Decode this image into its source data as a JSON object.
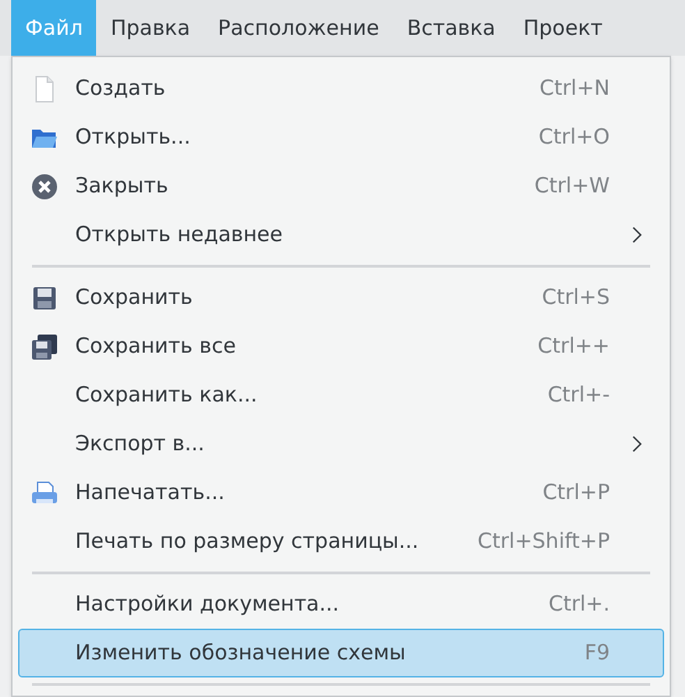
{
  "menubar": [
    {
      "label": "Файл",
      "selected": true
    },
    {
      "label": "Правка",
      "selected": false
    },
    {
      "label": "Расположение",
      "selected": false
    },
    {
      "label": "Вставка",
      "selected": false
    },
    {
      "label": "Проект",
      "selected": false
    }
  ],
  "menu": [
    {
      "kind": "item",
      "label": "Создать",
      "shortcut": "Ctrl+N",
      "selected": false
    },
    {
      "kind": "item",
      "label": "Открыть...",
      "shortcut": "Ctrl+O",
      "selected": false
    },
    {
      "kind": "item",
      "label": "Закрыть",
      "shortcut": "Ctrl+W",
      "selected": false
    },
    {
      "kind": "submenu",
      "label": "Открыть недавнее",
      "selected": false
    },
    {
      "kind": "separator"
    },
    {
      "kind": "item",
      "label": "Сохранить",
      "shortcut": "Ctrl+S",
      "selected": false
    },
    {
      "kind": "item",
      "label": "Сохранить все",
      "shortcut": "Ctrl++",
      "selected": false
    },
    {
      "kind": "item",
      "label": "Сохранить как...",
      "shortcut": "Ctrl+-",
      "selected": false
    },
    {
      "kind": "submenu",
      "label": "Экспорт в...",
      "selected": false
    },
    {
      "kind": "item",
      "label": "Напечатать...",
      "shortcut": "Ctrl+P",
      "selected": false
    },
    {
      "kind": "item",
      "label": "Печать по размеру страницы...",
      "shortcut": "Ctrl+Shift+P",
      "selected": false
    },
    {
      "kind": "separator"
    },
    {
      "kind": "item",
      "label": "Настройки документа...",
      "shortcut": "Ctrl+.",
      "selected": false
    },
    {
      "kind": "item",
      "label": "Изменить обозначение схемы",
      "shortcut": "F9",
      "selected": true
    },
    {
      "kind": "separator"
    }
  ]
}
